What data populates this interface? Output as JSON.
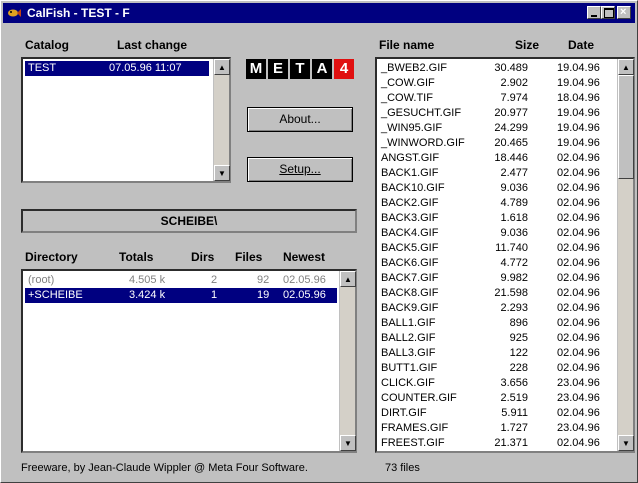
{
  "window": {
    "title": "CalFish - TEST - F"
  },
  "catalog": {
    "header_catalog": "Catalog",
    "header_last_change": "Last change",
    "items": [
      {
        "name": "TEST",
        "date": "07.05.96 11:07"
      }
    ]
  },
  "logo": {
    "letters": [
      "M",
      "E",
      "T",
      "A",
      "4"
    ]
  },
  "buttons": {
    "about": "About...",
    "setup": "Setup..."
  },
  "path": "SCHEIBE\\",
  "directory": {
    "headers": {
      "directory": "Directory",
      "totals": "Totals",
      "dirs": "Dirs",
      "files": "Files",
      "newest": "Newest"
    },
    "rows": [
      {
        "name": "(root)",
        "totals": "4.505 k",
        "dirs": "2",
        "files": "92",
        "newest": "02.05.96"
      },
      {
        "name": "+SCHEIBE",
        "totals": "3.424 k",
        "dirs": "1",
        "files": "19",
        "newest": "02.05.96"
      }
    ]
  },
  "files": {
    "headers": {
      "name": "File name",
      "size": "Size",
      "date": "Date"
    },
    "rows": [
      {
        "name": "_BWEB2.GIF",
        "size": "30.489",
        "date": "19.04.96"
      },
      {
        "name": "_COW.GIF",
        "size": "2.902",
        "date": "19.04.96"
      },
      {
        "name": "_COW.TIF",
        "size": "7.974",
        "date": "18.04.96"
      },
      {
        "name": "_GESUCHT.GIF",
        "size": "20.977",
        "date": "19.04.96"
      },
      {
        "name": "_WIN95.GIF",
        "size": "24.299",
        "date": "19.04.96"
      },
      {
        "name": "_WINWORD.GIF",
        "size": "20.465",
        "date": "19.04.96"
      },
      {
        "name": "ANGST.GIF",
        "size": "18.446",
        "date": "02.04.96"
      },
      {
        "name": "BACK1.GIF",
        "size": "2.477",
        "date": "02.04.96"
      },
      {
        "name": "BACK10.GIF",
        "size": "9.036",
        "date": "02.04.96"
      },
      {
        "name": "BACK2.GIF",
        "size": "4.789",
        "date": "02.04.96"
      },
      {
        "name": "BACK3.GIF",
        "size": "1.618",
        "date": "02.04.96"
      },
      {
        "name": "BACK4.GIF",
        "size": "9.036",
        "date": "02.04.96"
      },
      {
        "name": "BACK5.GIF",
        "size": "11.740",
        "date": "02.04.96"
      },
      {
        "name": "BACK6.GIF",
        "size": "4.772",
        "date": "02.04.96"
      },
      {
        "name": "BACK7.GIF",
        "size": "9.982",
        "date": "02.04.96"
      },
      {
        "name": "BACK8.GIF",
        "size": "21.598",
        "date": "02.04.96"
      },
      {
        "name": "BACK9.GIF",
        "size": "2.293",
        "date": "02.04.96"
      },
      {
        "name": "BALL1.GIF",
        "size": "896",
        "date": "02.04.96"
      },
      {
        "name": "BALL2.GIF",
        "size": "925",
        "date": "02.04.96"
      },
      {
        "name": "BALL3.GIF",
        "size": "122",
        "date": "02.04.96"
      },
      {
        "name": "BUTT1.GIF",
        "size": "228",
        "date": "02.04.96"
      },
      {
        "name": "CLICK.GIF",
        "size": "3.656",
        "date": "23.04.96"
      },
      {
        "name": "COUNTER.GIF",
        "size": "2.519",
        "date": "23.04.96"
      },
      {
        "name": "DIRT.GIF",
        "size": "5.911",
        "date": "02.04.96"
      },
      {
        "name": "FRAMES.GIF",
        "size": "1.727",
        "date": "23.04.96"
      },
      {
        "name": "FREEST.GIF",
        "size": "21.371",
        "date": "02.04.96"
      }
    ]
  },
  "status": {
    "left": "Freeware, by Jean-Claude Wippler @ Meta Four Software.",
    "right": "73 files"
  },
  "colors": {
    "title_bg": "#000080",
    "selection": "#000080",
    "logo_red": "#e01010"
  },
  "icons": [
    "fish-icon",
    "minimize-icon",
    "maximize-icon",
    "close-icon",
    "scroll-up-icon",
    "scroll-down-icon"
  ]
}
